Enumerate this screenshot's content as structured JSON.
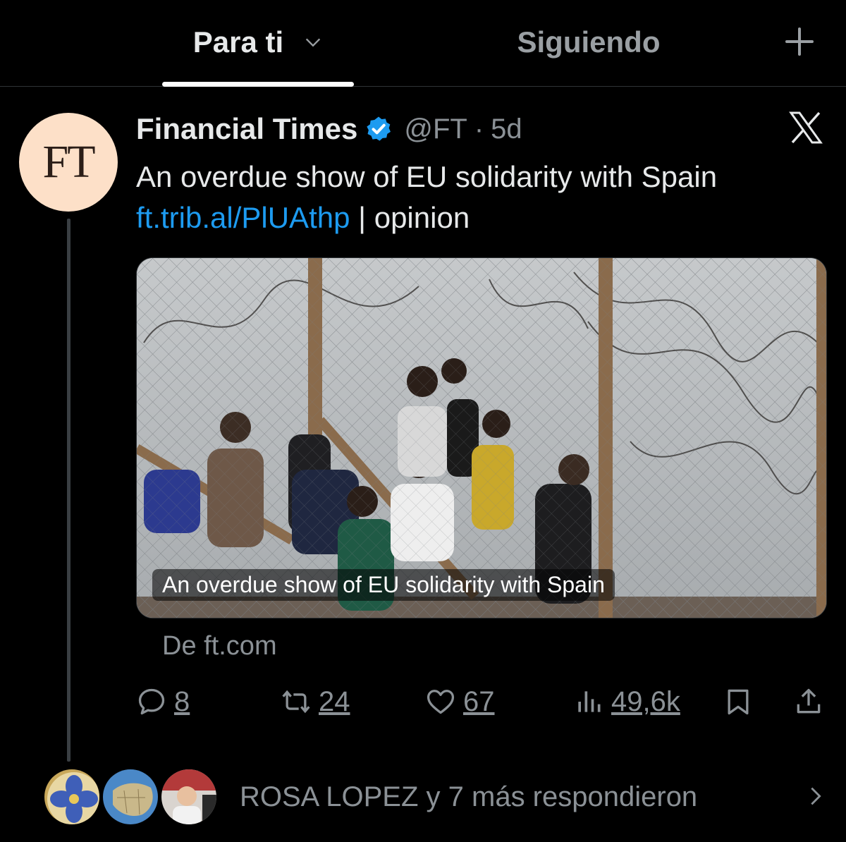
{
  "tabs": {
    "for_you": "Para ti",
    "following": "Siguiendo"
  },
  "tweet": {
    "author": "Financial Times",
    "avatar_text": "FT",
    "handle": "@FT",
    "separator": "·",
    "time": "5d",
    "text": "An overdue show of EU solidarity with Spain",
    "link": "ft.trib.al/PlUAthp",
    "link_suffix": " | opinion",
    "media_caption": "An overdue show of EU solidarity with Spain",
    "source": "De ft.com",
    "stats": {
      "replies": "8",
      "reposts": "24",
      "likes": "67",
      "views": "49,6k"
    }
  },
  "replies_summary": "ROSA LOPEZ y 7 más respondieron",
  "icons": {
    "for_you_dropdown": "chevron-down-icon",
    "add_tab": "plus-icon",
    "verified": "verified-badge-icon",
    "grok": "x-logo-icon",
    "reply": "reply-icon",
    "repost": "repost-icon",
    "like": "heart-icon",
    "views": "views-icon",
    "bookmark": "bookmark-icon",
    "share": "share-icon",
    "more_replies": "chevron-right-icon"
  },
  "colors": {
    "background": "#000000",
    "text": "#e7e9ea",
    "secondary": "#8b9196",
    "link": "#1d9bf0",
    "verified": "#1d9bf0",
    "ft_avatar": "#fde0c8"
  }
}
